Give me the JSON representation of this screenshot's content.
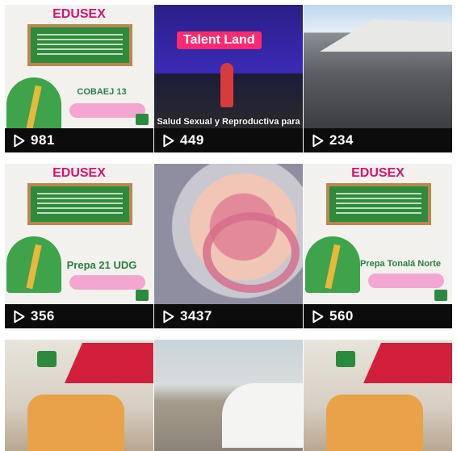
{
  "grid": {
    "tiles": [
      {
        "kind": "poster",
        "brand": "EDUSEX",
        "place": "COBAEJ 13",
        "views": "981"
      },
      {
        "kind": "talent",
        "sign": "Talent Land",
        "caption": "Salud Sexual y Reproductiva para Adolescentes",
        "views": "449"
      },
      {
        "kind": "crowd",
        "views": "234"
      },
      {
        "kind": "poster",
        "brand": "EDUSEX",
        "place": "Prepa 21 UDG",
        "views": "356"
      },
      {
        "kind": "anatomy",
        "views": "3437"
      },
      {
        "kind": "poster",
        "brand": "EDUSEX",
        "place": "Prepa Tonalá Norte",
        "views": "560"
      },
      {
        "kind": "truck"
      },
      {
        "kind": "street"
      },
      {
        "kind": "truck"
      }
    ]
  },
  "icons": {
    "play": "play-icon"
  }
}
